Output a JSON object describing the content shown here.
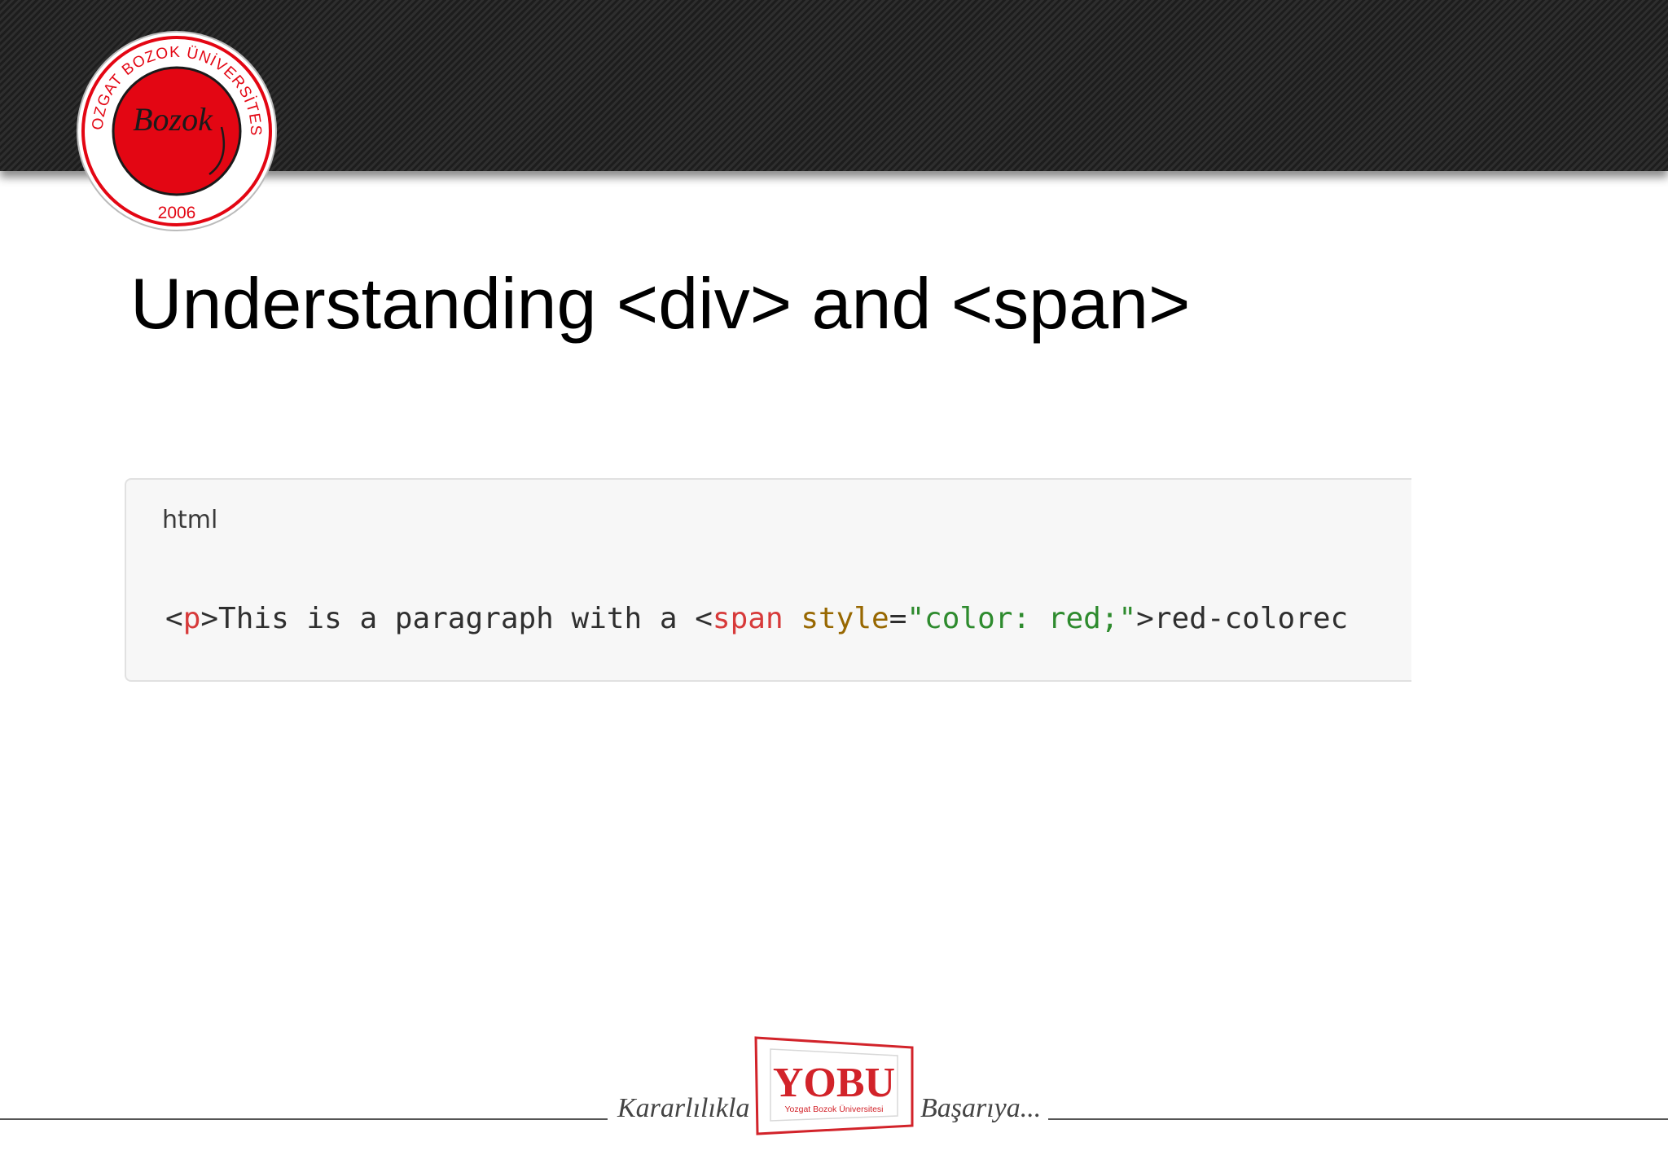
{
  "header": {
    "logo": {
      "arc_text": "YOZGAT BOZOK ÜNİVERSİTESİ",
      "center_script": "Bozok",
      "year": "2006",
      "color": "#e30613"
    }
  },
  "slide": {
    "title": "Understanding <div> and <span>"
  },
  "code_block": {
    "language": "html",
    "tokens": [
      {
        "text": "<",
        "kind": "punct"
      },
      {
        "text": "p",
        "kind": "tag"
      },
      {
        "text": ">This is a paragraph with a <",
        "kind": "plain"
      },
      {
        "text": "span",
        "kind": "tag"
      },
      {
        "text": " ",
        "kind": "plain"
      },
      {
        "text": "style",
        "kind": "attr"
      },
      {
        "text": "=",
        "kind": "plain"
      },
      {
        "text": "\"color: red;\"",
        "kind": "string"
      },
      {
        "text": ">red-colorec",
        "kind": "plain"
      }
    ],
    "colors": {
      "tag": "#d73a3a",
      "attr": "#986801",
      "string": "#2e8b2e",
      "text": "#2f2f2f"
    }
  },
  "footer": {
    "left_text": "Kararlılıkla",
    "right_text": "Başarıya...",
    "logo_text": "YOBU",
    "logo_subtitle": "Yozgat Bozok Üniversitesi",
    "logo_color": "#d2232a"
  }
}
